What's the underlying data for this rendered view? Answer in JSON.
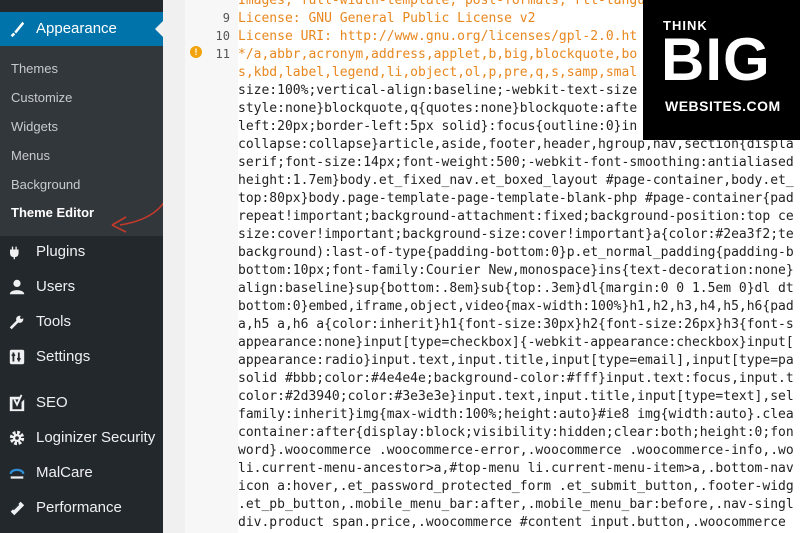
{
  "sidebar": {
    "active_menu": {
      "label": "Appearance",
      "icon": "paintbrush-icon"
    },
    "submenu": [
      {
        "label": "Themes"
      },
      {
        "label": "Customize"
      },
      {
        "label": "Widgets"
      },
      {
        "label": "Menus"
      },
      {
        "label": "Background"
      },
      {
        "label": "Theme Editor",
        "current": true
      }
    ],
    "items": [
      {
        "label": "Plugins",
        "icon": "plug-icon"
      },
      {
        "label": "Users",
        "icon": "user-icon"
      },
      {
        "label": "Tools",
        "icon": "wrench-icon"
      },
      {
        "label": "Settings",
        "icon": "settings-icon"
      },
      {
        "label": "SEO",
        "icon": "yoast-seo-icon"
      },
      {
        "label": "Loginizer Security",
        "icon": "gear-icon"
      },
      {
        "label": "MalCare",
        "icon": "malcare-icon"
      },
      {
        "label": "Performance",
        "icon": "performance-icon"
      }
    ],
    "colors": {
      "background": "#23282d",
      "active": "#0073aa",
      "submenu_background": "#32373c"
    }
  },
  "editor": {
    "line_numbers": [
      "9",
      "10",
      "11"
    ],
    "warning_line": "11",
    "lines": [
      "Images, full-width-template, post-formats, rtl-langu",
      "License: GNU General Public License v2",
      "License URI: http://www.gnu.org/licenses/gpl-2.0.ht",
      "*/a,abbr,acronym,address,applet,b,big,blockquote,bo",
      "s,kbd,label,legend,li,object,ol,p,pre,q,s,samp,smal",
      "size:100%;vertical-align:baseline;-webkit-text-size",
      "style:none}blockquote,q{quotes:none}blockquote:afte",
      "left:20px;border-left:5px solid}:focus{outline:0}in",
      "collapse:collapse}article,aside,footer,header,hgroup,nav,section{displa",
      "serif;font-size:14px;font-weight:500;-webkit-font-smoothing:antialiased",
      "height:1.7em}body.et_fixed_nav.et_boxed_layout #page-container,body.et_",
      "top:80px}body.page-template-page-template-blank-php #page-container{pad",
      "repeat!important;background-attachment:fixed;background-position:top ce",
      "size:cover!important;background-size:cover!important}a{color:#2ea3f2;te",
      "background):last-of-type{padding-bottom:0}p.et_normal_padding{padding-b",
      "bottom:10px;font-family:Courier New,monospace}ins{text-decoration:none}",
      "align:baseline}sup{bottom:.8em}sub{top:.3em}dl{margin:0 0 1.5em 0}dl dt",
      "bottom:0}embed,iframe,object,video{max-width:100%}h1,h2,h3,h4,h5,h6{pad",
      "a,h5 a,h6 a{color:inherit}h1{font-size:30px}h2{font-size:26px}h3{font-s",
      "appearance:none}input[type=checkbox]{-webkit-appearance:checkbox}input[",
      "appearance:radio}input.text,input.title,input[type=email],input[type=pa",
      "solid #bbb;color:#4e4e4e;background-color:#fff}input.text:focus,input.t",
      "color:#2d3940;color:#3e3e3e}input.text,input.title,input[type=text],sel",
      "family:inherit}img{max-width:100%;height:auto}#ie8 img{width:auto}.clea",
      "container:after{display:block;visibility:hidden;clear:both;height:0;fon",
      "word}.woocommerce .woocommerce-error,.woocommerce .woocommerce-info,.wo",
      "li.current-menu-ancestor>a,#top-menu li.current-menu-item>a,.bottom-nav",
      "icon a:hover,.et_password_protected_form .et_submit_button,.footer-widg",
      ".et_pb_button,.mobile_menu_bar:after,.mobile_menu_bar:before,.nav-singl",
      "div.product span.price,.woocommerce #content input.button,.woocommerce"
    ],
    "header_color": "#e8871e"
  },
  "logo": {
    "think": "THINK",
    "big": "BIG",
    "websites": "WEBSITES.COM"
  }
}
